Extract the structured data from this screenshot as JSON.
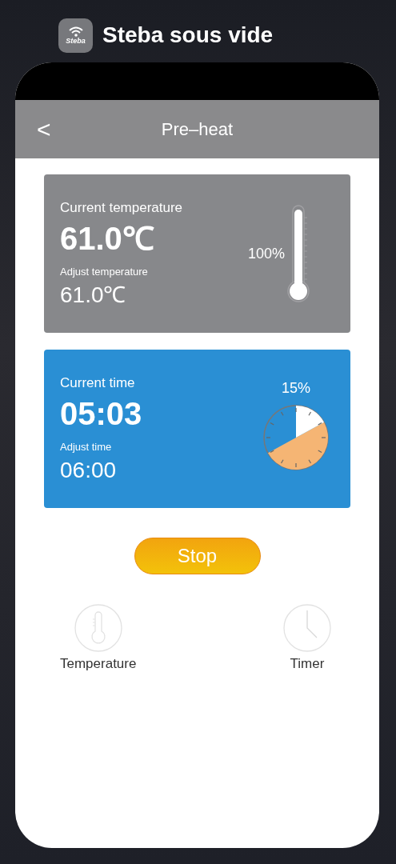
{
  "app_switcher": {
    "app_name": "Steba sous vide",
    "icon_text": "Steba"
  },
  "header": {
    "back": "<",
    "title": "Pre–heat"
  },
  "temperature_card": {
    "label": "Current temperature",
    "value": "61.0℃",
    "adjust_label": "Adjust temperature",
    "adjust_value": "61.0℃",
    "percent": "100%",
    "level": 1.0
  },
  "time_card": {
    "label": "Current time",
    "value": "05:03",
    "adjust_label": "Adjust time",
    "adjust_value": "06:00",
    "percent": "15%"
  },
  "stop_button": "Stop",
  "nav": [
    {
      "kind": "temperature",
      "label": "Temperature"
    },
    {
      "kind": "timer",
      "label": "Timer"
    }
  ]
}
